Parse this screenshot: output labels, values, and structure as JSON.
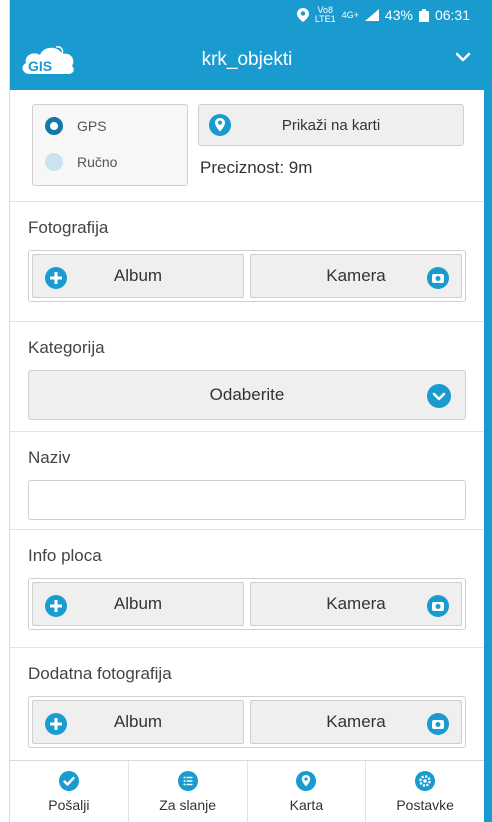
{
  "status_bar": {
    "battery": "43%",
    "time": "06:31",
    "volte_top": "Vo8",
    "volte_bottom": "LTE1",
    "network": "4G+"
  },
  "header": {
    "logo_text": "GIS",
    "title": "krk_objekti"
  },
  "location": {
    "gps_label": "GPS",
    "manual_label": "Ručno",
    "show_map_label": "Prikaži na karti",
    "precision_text": "Preciznost: 9m"
  },
  "photo": {
    "label": "Fotografija",
    "album_label": "Album",
    "camera_label": "Kamera"
  },
  "category": {
    "label": "Kategorija",
    "selected": "Odaberite"
  },
  "name": {
    "label": "Naziv",
    "value": ""
  },
  "info_plate": {
    "label": "Info ploca",
    "album_label": "Album",
    "camera_label": "Kamera"
  },
  "extra_photo": {
    "label": "Dodatna fotografija",
    "album_label": "Album",
    "camera_label": "Kamera"
  },
  "bottom_nav": {
    "send": "Pošalji",
    "queue": "Za slanje",
    "map": "Karta",
    "settings": "Postavke"
  },
  "colors": {
    "accent": "#1a9bcf",
    "radio_on": "#1478a8",
    "button_bg": "#efefef"
  },
  "icons": [
    "location-pin-icon",
    "signal-icon",
    "battery-icon",
    "cloud-logo",
    "chevron-down-icon",
    "map-pin-icon",
    "plus-icon",
    "camera-icon",
    "check-icon",
    "list-icon",
    "gear-icon"
  ]
}
